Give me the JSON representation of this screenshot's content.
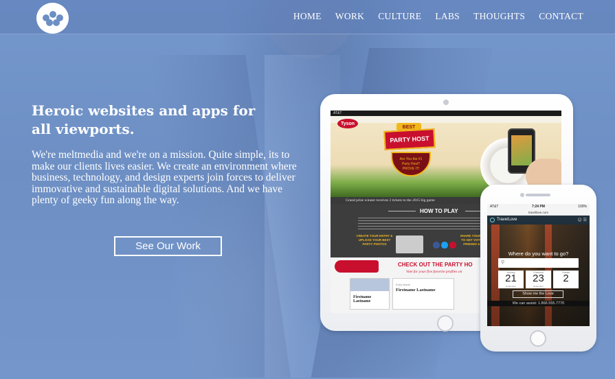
{
  "nav": {
    "items": [
      "HOME",
      "WORK",
      "CULTURE",
      "LABS",
      "THOUGHTS",
      "CONTACT"
    ]
  },
  "hero": {
    "headline_regular": "Heroic websites and apps ",
    "headline_bold_1": "for",
    "headline_bold_2": "all viewports.",
    "intro": "We're meltmedia and we're on a mission. Quite simple, its to make our clients lives easier. We create an environment where business, technology, and design experts join forces to deliver immovative and sustainable digital solutions. And we have plenty of geeky fun along the way.",
    "cta_label": "See Our Work"
  },
  "tablet": {
    "status_carrier": "AT&T",
    "brand": "Tyson",
    "best": "BEST",
    "badge": "PARTY HOST",
    "shield_line1": "Are You the #1",
    "shield_line2": "Party Host?",
    "shield_line3": "PROVE IT!",
    "winner_text": "Grand prize winner receives 2 tickets to the 2015 big game",
    "howto_title": "HOW TO PLAY",
    "step1": "CREATE YOUR ENTRY & UPLOAD YOUR BEST PARTY PHOTOS",
    "step2": "SHARE YOUR PROFILE TO GET VOTES FROM FRIENDS & FAMILY",
    "party_title": "CHECK OUT THE PARTY HO",
    "party_sub": "Vote for your five favorite profiles on",
    "card1_name": "Firstname Lastname",
    "card2_label": "Entry Name",
    "card2_name": "Firstname Lastname"
  },
  "phone": {
    "carrier": "AT&T",
    "time": "7:24 PM",
    "battery": "100%",
    "url": "travellove.com",
    "app_name": "TravelLove",
    "where_prompt": "Where do you want to go?",
    "dates": [
      {
        "label": "Arriving",
        "num": "21",
        "sub": "September"
      },
      {
        "label": "Checkout",
        "num": "23",
        "sub": "September"
      },
      {
        "label": "Guests",
        "num": "2",
        "sub": ""
      }
    ],
    "love_button": "Show me the Love",
    "assist": "We can assist: 1.866.555.7770"
  }
}
